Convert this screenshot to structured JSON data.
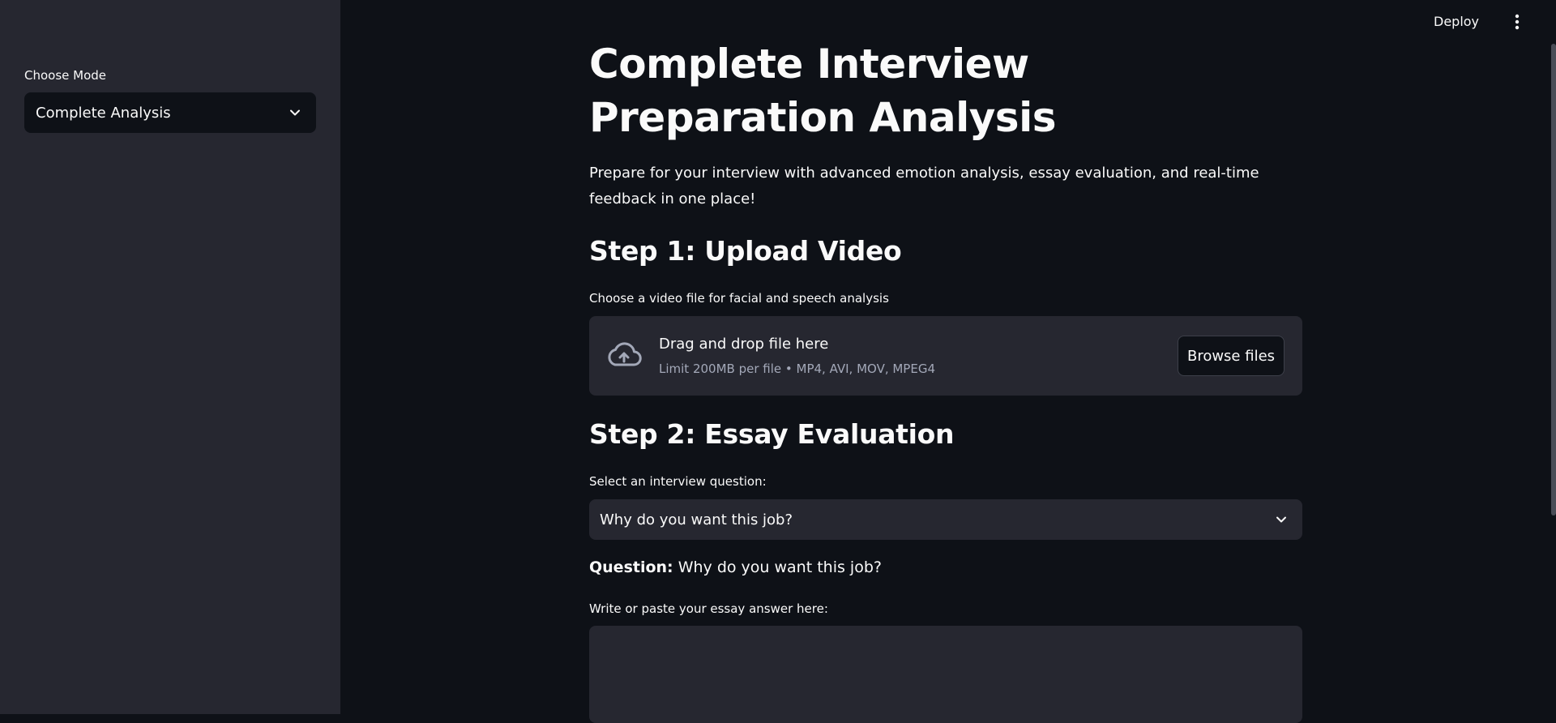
{
  "sidebar": {
    "mode_label": "Choose Mode",
    "mode_value": "Complete Analysis"
  },
  "topbar": {
    "deploy_label": "Deploy",
    "menu_icon": "vertical-ellipsis-icon"
  },
  "main": {
    "title": "Complete Interview Preparation Analysis",
    "intro": "Prepare for your interview with advanced emotion analysis, essay evaluation, and real-time feedback in one place!",
    "step1": {
      "heading": "Step 1: Upload Video",
      "label": "Choose a video file for facial and speech analysis",
      "uploader": {
        "icon": "cloud-upload-icon",
        "drag_text": "Drag and drop file here",
        "limit_text": "Limit 200MB per file • MP4, AVI, MOV, MPEG4",
        "browse_label": "Browse files"
      }
    },
    "step2": {
      "heading": "Step 2: Essay Evaluation",
      "question_label": "Select an interview question:",
      "question_value": "Why do you want this job?",
      "question_prefix": "Question:",
      "question_text": "Why do you want this job?",
      "essay_label": "Write or paste your essay answer here:",
      "essay_value": ""
    }
  },
  "colors": {
    "background": "#0e1117",
    "sidebar": "#262730",
    "widget": "#262730",
    "text": "#fafafa",
    "muted_text": "#a3a8b8"
  }
}
